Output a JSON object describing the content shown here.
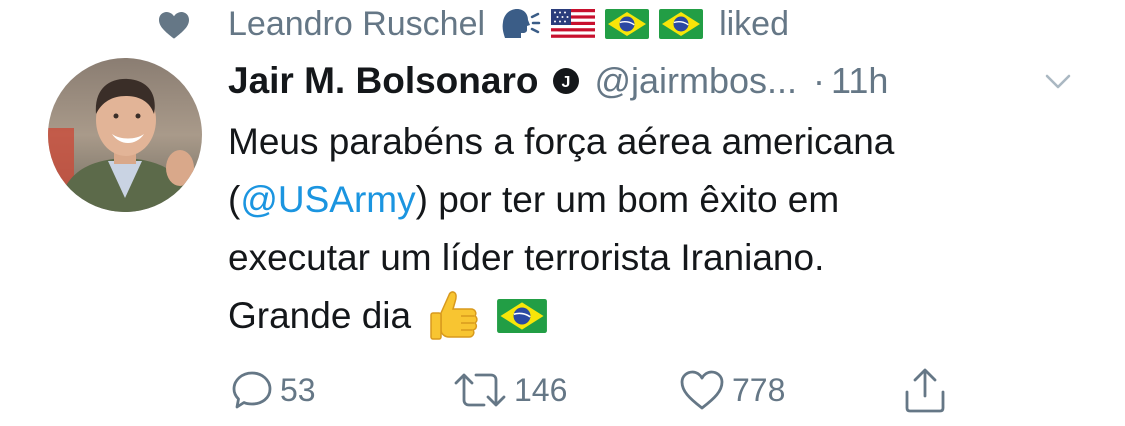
{
  "context": {
    "name": "Leandro Ruschel",
    "action": "liked",
    "emojis": [
      "speaking-head-icon",
      "us-flag-icon",
      "brazil-flag-icon",
      "brazil-flag-icon"
    ]
  },
  "tweet": {
    "author_name": "Jair M. Bolsonaro",
    "verified_badge": "J",
    "handle": "@jairmbos...",
    "separator": "·",
    "time": "11h",
    "body": {
      "line1": "Meus parabéns a força aérea americana",
      "line2_open": "(",
      "mention": "@USArmy",
      "line2_rest": ") por ter um bom êxito em",
      "line3": "executar um líder terrorista Iraniano.",
      "line4": "Grande dia"
    },
    "replies": "53",
    "retweets": "146",
    "likes": "778"
  },
  "colors": {
    "text": "#14171a",
    "secondary": "#657786",
    "link": "#1b95e0"
  }
}
